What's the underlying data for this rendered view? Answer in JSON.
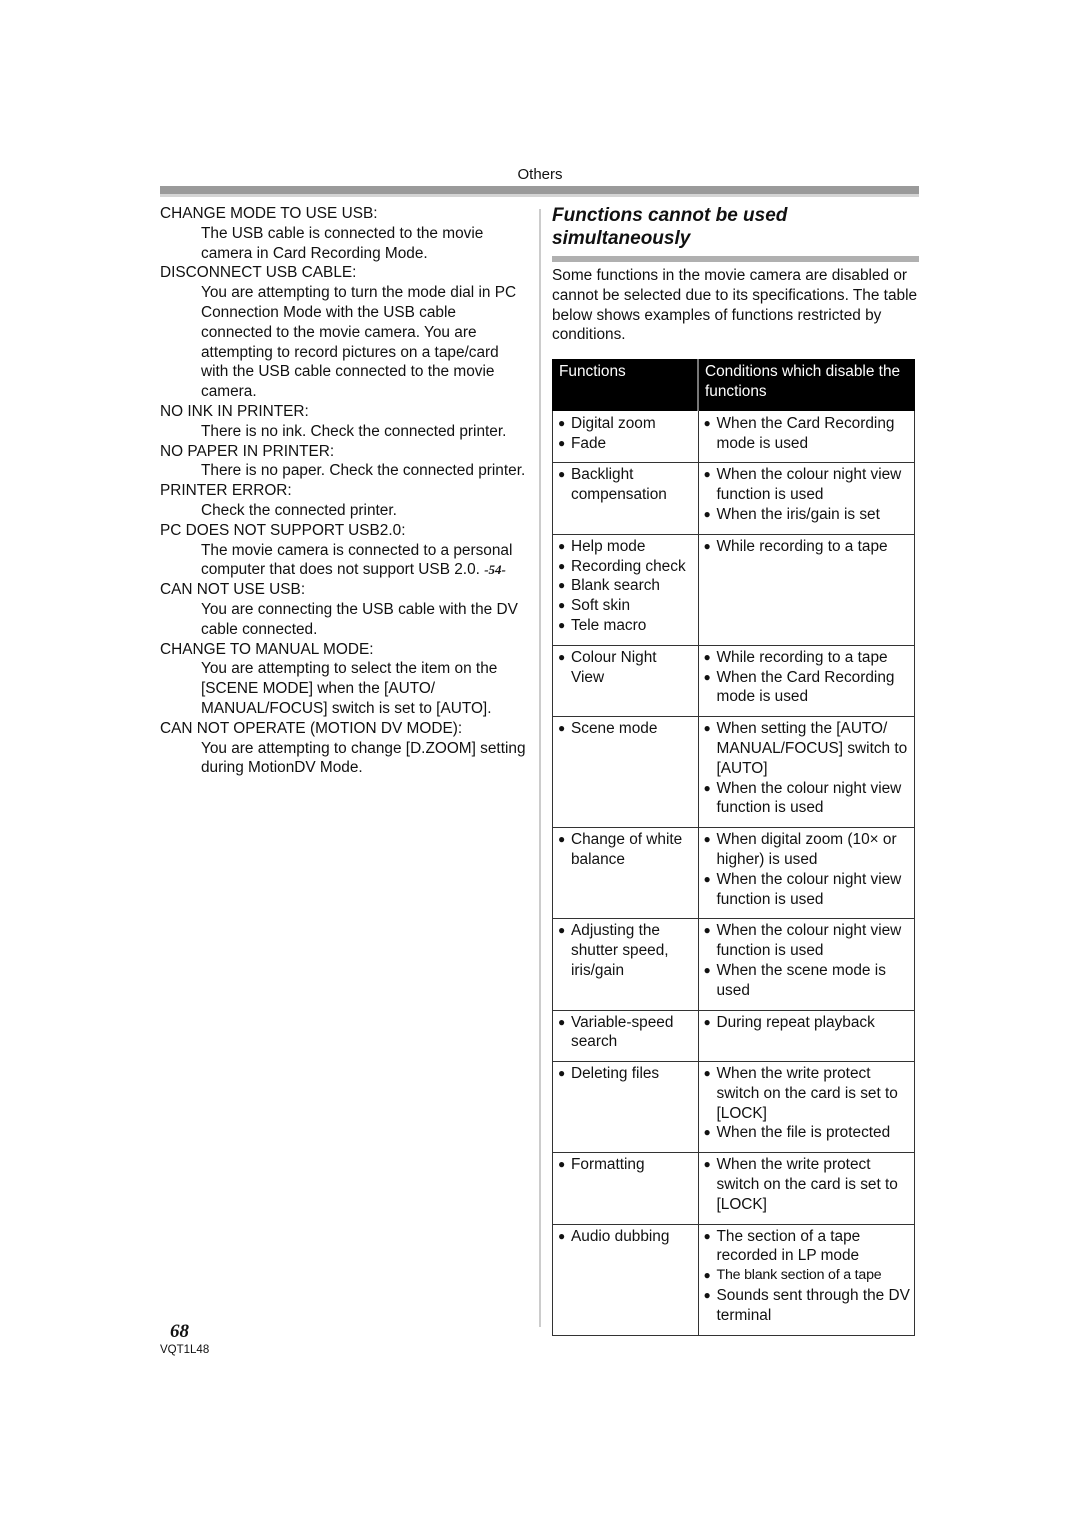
{
  "header": {
    "section_label": "Others"
  },
  "left_column": {
    "messages": [
      {
        "title": "CHANGE MODE TO USE USB:",
        "body": "The USB cable is connected to the movie camera in Card Recording Mode.",
        "ref": ""
      },
      {
        "title": "DISCONNECT USB CABLE:",
        "body": "You are attempting to turn the mode dial in PC Connection Mode with the USB cable connected to the movie camera. You are attempting to record pictures on a tape/card with the USB cable connected to the movie camera.",
        "ref": ""
      },
      {
        "title": "NO INK IN PRINTER:",
        "body": "There is no ink. Check the connected printer.",
        "ref": ""
      },
      {
        "title": "NO PAPER IN PRINTER:",
        "body": "There is no paper. Check the connected printer.",
        "ref": ""
      },
      {
        "title": "PRINTER ERROR:",
        "body": "Check the connected printer.",
        "ref": ""
      },
      {
        "title": "PC DOES NOT SUPPORT USB2.0:",
        "body": "The movie camera is connected to a personal computer that does not support USB 2.0. ",
        "ref": "-54-"
      },
      {
        "title": "CAN NOT USE USB:",
        "body": "You are connecting the USB cable with the DV cable connected.",
        "ref": ""
      },
      {
        "title": "CHANGE TO MANUAL MODE:",
        "body": "You are attempting to select the item on the [SCENE MODE] when the [AUTO/ MANUAL/FOCUS] switch is set to [AUTO].",
        "ref": ""
      },
      {
        "title": "CAN NOT OPERATE (MOTION DV MODE):",
        "body": "You are attempting to change [D.ZOOM] setting during MotionDV Mode.",
        "ref": ""
      }
    ]
  },
  "right_column": {
    "title": "Functions cannot be used simultaneously",
    "intro": "Some functions in the movie camera are disabled or cannot be selected due to its specifications. The table below shows examples of functions restricted by conditions.",
    "table": {
      "headers": [
        "Functions",
        "Conditions which disable the functions"
      ],
      "bullet_glyph": "●",
      "rows": [
        {
          "functions": [
            "Digital zoom",
            "Fade"
          ],
          "conditions": [
            "When the Card Recording mode is used"
          ]
        },
        {
          "functions": [
            "Backlight compensation"
          ],
          "conditions": [
            "When the colour night view function is used",
            "When the iris/gain is set"
          ]
        },
        {
          "functions": [
            "Help mode",
            "Recording check",
            "Blank search",
            "Soft skin",
            "Tele macro"
          ],
          "conditions": [
            "While recording to a tape"
          ]
        },
        {
          "functions": [
            "Colour Night View"
          ],
          "conditions": [
            "While recording to a tape",
            "When the Card Recording mode is used"
          ]
        },
        {
          "functions": [
            "Scene mode"
          ],
          "conditions": [
            "When setting the [AUTO/ MANUAL/FOCUS] switch to [AUTO]",
            "When the colour night view function is used"
          ]
        },
        {
          "functions": [
            "Change of white balance"
          ],
          "conditions": [
            "When digital zoom (10× or higher) is used",
            "When the colour night view function is used"
          ]
        },
        {
          "functions": [
            "Adjusting the shutter speed, iris/gain"
          ],
          "conditions": [
            "When the colour night view function is used",
            "When the scene mode is used"
          ]
        },
        {
          "functions": [
            "Variable-speed search"
          ],
          "conditions": [
            "During repeat playback"
          ]
        },
        {
          "functions": [
            "Deleting files"
          ],
          "conditions": [
            "When the write protect switch on the card is set to [LOCK]",
            "When the file is protected"
          ]
        },
        {
          "functions": [
            "Formatting"
          ],
          "conditions": [
            "When the write protect switch on the card is set to [LOCK]"
          ]
        },
        {
          "functions": [
            "Audio dubbing"
          ],
          "conditions": [
            "The section of a tape recorded in LP mode",
            "The blank section of a tape",
            "Sounds sent through the DV terminal"
          ]
        }
      ]
    }
  },
  "footer": {
    "page_number": "68",
    "doc_code": "VQT1L48"
  }
}
